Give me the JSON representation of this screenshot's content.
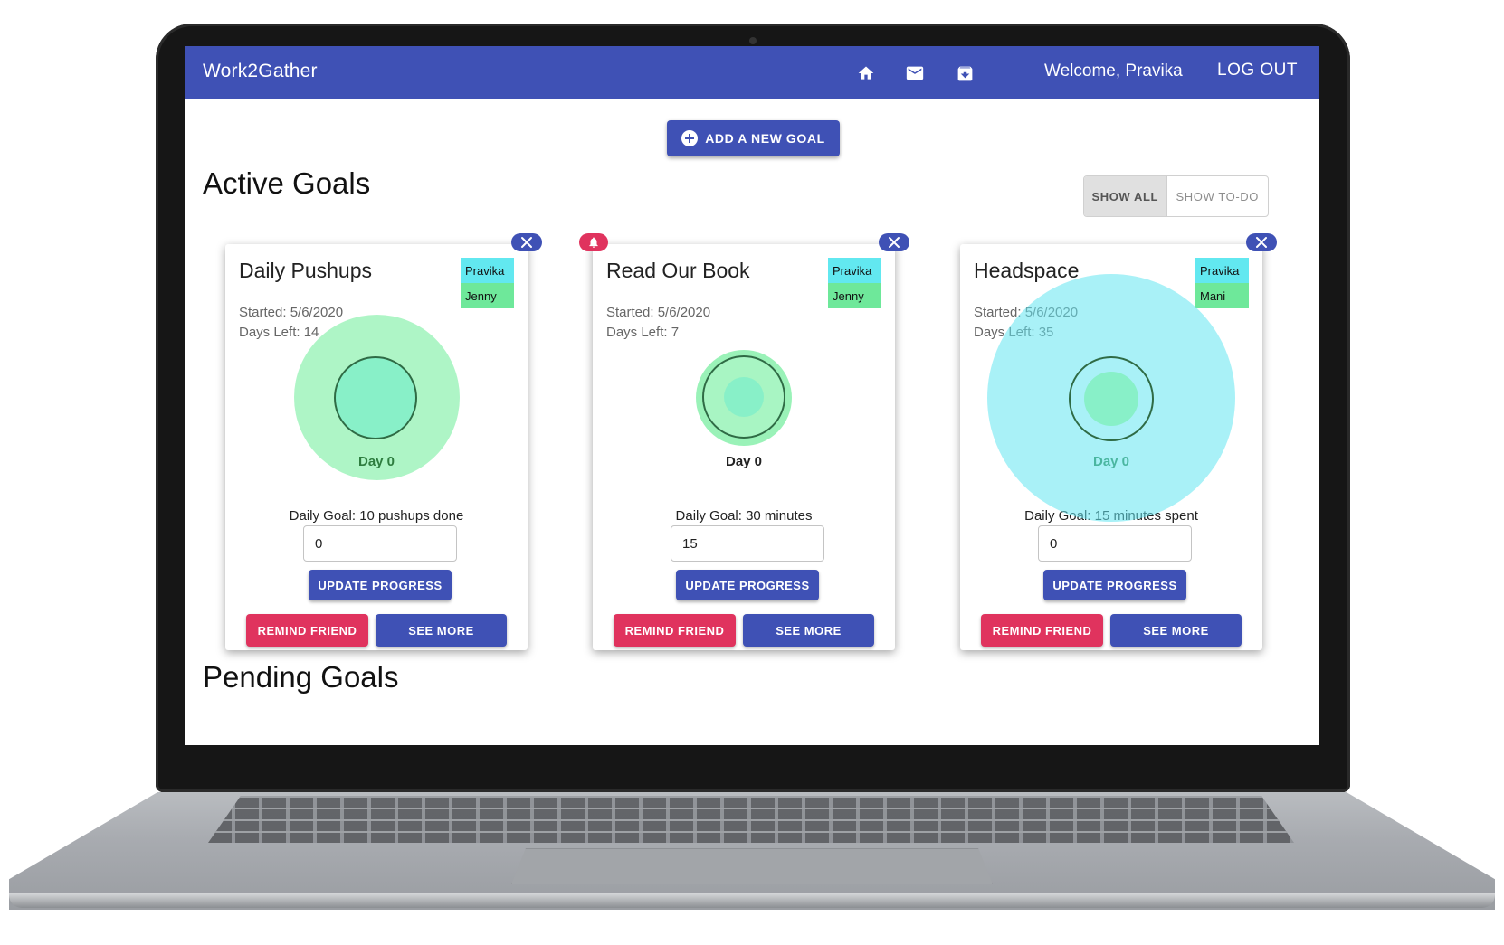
{
  "app": {
    "brand": "Work2Gather",
    "welcome": "Welcome, Pravika",
    "logout_label": "LOG OUT",
    "nav_icons": [
      "home-icon",
      "mail-icon",
      "archive-icon"
    ]
  },
  "actions": {
    "add_goal_label": "ADD A NEW GOAL"
  },
  "sections": {
    "active_title": "Active Goals",
    "pending_title": "Pending Goals"
  },
  "filter": {
    "show_all": "SHOW ALL",
    "show_todo": "SHOW TO-DO",
    "selected": "SHOW ALL"
  },
  "colors": {
    "primary": "#3f51b5",
    "accent": "#e0335e",
    "member_primary": "#62e8f0",
    "member_partner": "#6ee89a"
  },
  "goals": [
    {
      "title": "Daily Pushups",
      "members": [
        "Pravika",
        "Jenny"
      ],
      "started": "Started: 5/6/2020",
      "days_left": "Days Left: 14",
      "day_label": "Day 0",
      "daily_goal": "Daily Goal: 10 pushups done",
      "progress_value": "0",
      "update_label": "UPDATE PROGRESS",
      "remind_label": "REMIND FRIEND",
      "see_more_label": "SEE MORE",
      "has_notification": false
    },
    {
      "title": "Read Our Book",
      "members": [
        "Pravika",
        "Jenny"
      ],
      "started": "Started: 5/6/2020",
      "days_left": "Days Left: 7",
      "day_label": "Day 0",
      "daily_goal": "Daily Goal: 30 minutes",
      "progress_value": "15",
      "update_label": "UPDATE PROGRESS",
      "remind_label": "REMIND FRIEND",
      "see_more_label": "SEE MORE",
      "has_notification": true
    },
    {
      "title": "Headspace",
      "members": [
        "Pravika",
        "Mani"
      ],
      "started": "Started: 5/6/2020",
      "days_left": "Days Left: 35",
      "day_label": "Day 0",
      "daily_goal": "Daily Goal: 15 minutes spent",
      "progress_value": "0",
      "update_label": "UPDATE PROGRESS",
      "remind_label": "REMIND FRIEND",
      "see_more_label": "SEE MORE",
      "has_notification": false
    }
  ]
}
